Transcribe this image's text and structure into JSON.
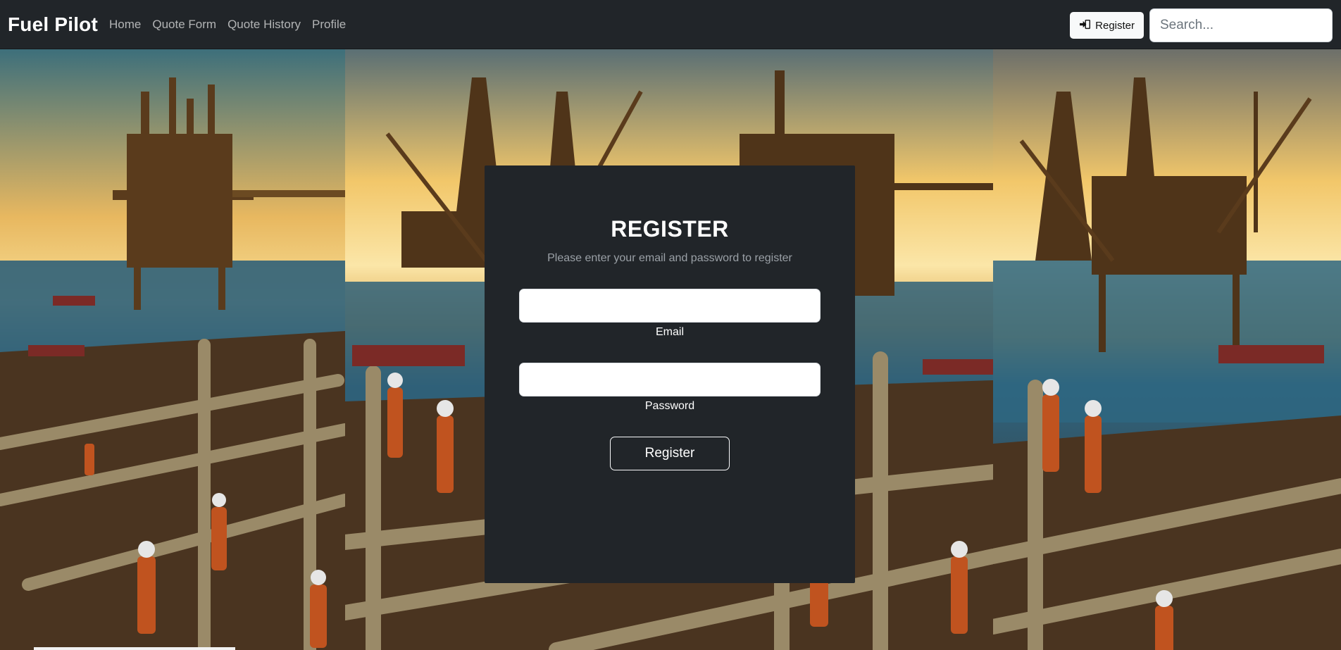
{
  "navbar": {
    "brand": "Fuel Pilot",
    "links": [
      "Home",
      "Quote Form",
      "Quote History",
      "Profile"
    ],
    "register_label": "Register",
    "register_icon": "sign-in-icon",
    "search_placeholder": "Search..."
  },
  "card": {
    "title": "REGISTER",
    "subtitle": "Please enter your email and password to register",
    "email_label": "Email",
    "email_value": "",
    "password_label": "Password",
    "password_value": "",
    "submit_label": "Register"
  },
  "colors": {
    "navbar_bg": "#212529",
    "card_bg": "#212529",
    "sky_top": "#3f6f7a",
    "sky_glow": "#f6d27a",
    "sea": "#2d5a74",
    "rig": "#6b4a22",
    "pipes": "#8a7a5a"
  }
}
